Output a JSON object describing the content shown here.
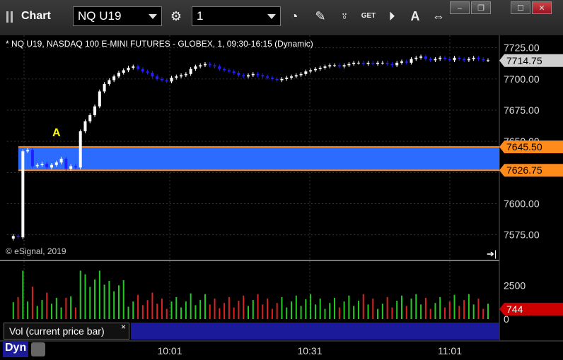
{
  "window": {
    "title": "Chart",
    "symbol": "NQ U19",
    "interval": "1",
    "controls": {
      "minimize": "‒",
      "restore": "❐",
      "maximize": "☐",
      "close": "✕"
    }
  },
  "toolbar": {
    "icons": [
      "gear-icon",
      "clock-icon",
      "pencil-icon",
      "study-icon",
      "get-icon",
      "play-icon",
      "auto-icon",
      "arrows-icon"
    ],
    "get_label": "GET",
    "auto_label": "A"
  },
  "chart": {
    "legend": "* NQ U19, NASDAQ 100 E-MINI FUTURES - GLOBEX, 1, 09:30-16:15 (Dynamic)",
    "copyright": "© eSignal, 2019",
    "annotation": "A",
    "vol_label": "Vol (current price bar)",
    "vol_close": "×",
    "dyn_label": "Dyn",
    "colors": {
      "up": "#ffffff",
      "down": "#2020ff",
      "zone": "#2b6cff",
      "zone_line": "#ff8c1a",
      "vol_up": "#22cc22",
      "vol_down": "#dd2222",
      "marker": "#ffff00"
    }
  },
  "chart_data": {
    "type": "candlestick",
    "title": "",
    "price_axis": {
      "ticks": [
        7725.0,
        7700.0,
        7675.0,
        7650.0,
        7600.0,
        7575.0
      ],
      "ylim": [
        7555,
        7735
      ]
    },
    "time_axis": {
      "ticks": [
        "10:01",
        "10:31",
        "11:01"
      ]
    },
    "last_price": 7714.75,
    "zone": {
      "high": 7645.5,
      "low": 7626.75
    },
    "volume": {
      "ticks": [
        2500,
        0
      ],
      "last": 744,
      "ylim": [
        0,
        4200
      ]
    },
    "price_path": [
      7572,
      7574,
      7573,
      7642,
      7643,
      7630,
      7631,
      7632,
      7629,
      7631,
      7633,
      7636,
      7628,
      7630,
      7629,
      7658,
      7666,
      7671,
      7678,
      7690,
      7696,
      7699,
      7702,
      7705,
      7707,
      7709,
      7710,
      7708,
      7706,
      7705,
      7702,
      7700,
      7699,
      7698,
      7701,
      7702,
      7703,
      7704,
      7708,
      7710,
      7711,
      7712,
      7711,
      7710,
      7708,
      7707,
      7706,
      7705,
      7703,
      7702,
      7703,
      7704,
      7703,
      7702,
      7701,
      7700,
      7699,
      7700,
      7701,
      7702,
      7703,
      7704,
      7706,
      7707,
      7708,
      7709,
      7710,
      7711,
      7711,
      7710,
      7711,
      7712,
      7713,
      7713,
      7712,
      7713,
      7712,
      7713,
      7713,
      7712,
      7711,
      7713,
      7714,
      7713,
      7716,
      7717,
      7718,
      7716,
      7715,
      7716,
      7717,
      7716,
      7715,
      7717,
      7716,
      7715,
      7716,
      7717,
      7716,
      7715,
      7715
    ]
  }
}
